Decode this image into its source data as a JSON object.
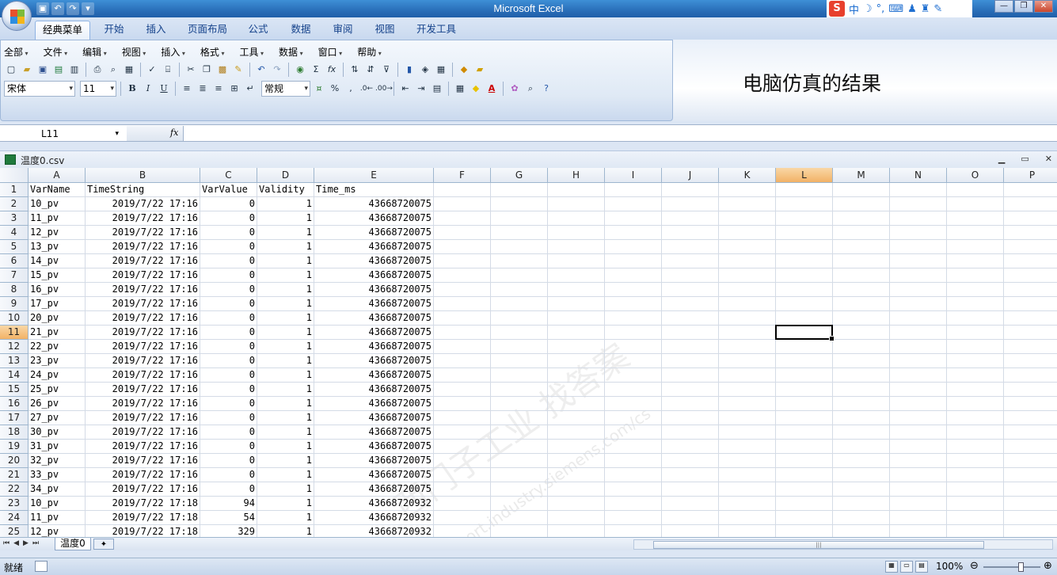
{
  "window": {
    "title": "Microsoft Excel"
  },
  "ime": {
    "logo": "S",
    "lang": "中",
    "moon": "☽",
    "punct": "°,",
    "kbd": "⌨",
    "user": "♟",
    "shirt": "♜",
    "tool": "✎"
  },
  "ribbon_tabs": [
    "经典菜单",
    "开始",
    "插入",
    "页面布局",
    "公式",
    "数据",
    "审阅",
    "视图",
    "开发工具"
  ],
  "classic_menu": [
    "全部",
    "文件",
    "编辑",
    "视图",
    "插入",
    "格式",
    "工具",
    "数据",
    "窗口",
    "帮助"
  ],
  "font": {
    "name": "宋体",
    "size": "11"
  },
  "number_format": "常规",
  "toolbar_glyphs": {
    "bold": "B",
    "italic": "I",
    "underline": "U",
    "percent": "%",
    "comma": ",",
    "sigma": "Σ",
    "fx": "fx",
    "font_color": "A"
  },
  "annotation": "电脑仿真的结果",
  "formula_bar": {
    "name_box": "L11",
    "fx_label": "fx",
    "formula": ""
  },
  "document": {
    "title": "温度0.csv"
  },
  "columns": [
    "A",
    "B",
    "C",
    "D",
    "E",
    "F",
    "G",
    "H",
    "I",
    "J",
    "K",
    "L",
    "M",
    "N",
    "O",
    "P"
  ],
  "selected_column": "L",
  "selected_row": 11,
  "rows": [
    {
      "n": 1,
      "a": "VarName",
      "b": "TimeString",
      "c": "VarValue",
      "d": "Validity",
      "e": "Time_ms",
      "header": true
    },
    {
      "n": 2,
      "a": "10_pv",
      "b": "2019/7/22 17:16",
      "c": "0",
      "d": "1",
      "e": "43668720075"
    },
    {
      "n": 3,
      "a": "11_pv",
      "b": "2019/7/22 17:16",
      "c": "0",
      "d": "1",
      "e": "43668720075"
    },
    {
      "n": 4,
      "a": "12_pv",
      "b": "2019/7/22 17:16",
      "c": "0",
      "d": "1",
      "e": "43668720075"
    },
    {
      "n": 5,
      "a": "13_pv",
      "b": "2019/7/22 17:16",
      "c": "0",
      "d": "1",
      "e": "43668720075"
    },
    {
      "n": 6,
      "a": "14_pv",
      "b": "2019/7/22 17:16",
      "c": "0",
      "d": "1",
      "e": "43668720075"
    },
    {
      "n": 7,
      "a": "15_pv",
      "b": "2019/7/22 17:16",
      "c": "0",
      "d": "1",
      "e": "43668720075"
    },
    {
      "n": 8,
      "a": "16_pv",
      "b": "2019/7/22 17:16",
      "c": "0",
      "d": "1",
      "e": "43668720075"
    },
    {
      "n": 9,
      "a": "17_pv",
      "b": "2019/7/22 17:16",
      "c": "0",
      "d": "1",
      "e": "43668720075"
    },
    {
      "n": 10,
      "a": "20_pv",
      "b": "2019/7/22 17:16",
      "c": "0",
      "d": "1",
      "e": "43668720075"
    },
    {
      "n": 11,
      "a": "21_pv",
      "b": "2019/7/22 17:16",
      "c": "0",
      "d": "1",
      "e": "43668720075"
    },
    {
      "n": 12,
      "a": "22_pv",
      "b": "2019/7/22 17:16",
      "c": "0",
      "d": "1",
      "e": "43668720075"
    },
    {
      "n": 13,
      "a": "23_pv",
      "b": "2019/7/22 17:16",
      "c": "0",
      "d": "1",
      "e": "43668720075"
    },
    {
      "n": 14,
      "a": "24_pv",
      "b": "2019/7/22 17:16",
      "c": "0",
      "d": "1",
      "e": "43668720075"
    },
    {
      "n": 15,
      "a": "25_pv",
      "b": "2019/7/22 17:16",
      "c": "0",
      "d": "1",
      "e": "43668720075"
    },
    {
      "n": 16,
      "a": "26_pv",
      "b": "2019/7/22 17:16",
      "c": "0",
      "d": "1",
      "e": "43668720075"
    },
    {
      "n": 17,
      "a": "27_pv",
      "b": "2019/7/22 17:16",
      "c": "0",
      "d": "1",
      "e": "43668720075"
    },
    {
      "n": 18,
      "a": "30_pv",
      "b": "2019/7/22 17:16",
      "c": "0",
      "d": "1",
      "e": "43668720075"
    },
    {
      "n": 19,
      "a": "31_pv",
      "b": "2019/7/22 17:16",
      "c": "0",
      "d": "1",
      "e": "43668720075"
    },
    {
      "n": 20,
      "a": "32_pv",
      "b": "2019/7/22 17:16",
      "c": "0",
      "d": "1",
      "e": "43668720075"
    },
    {
      "n": 21,
      "a": "33_pv",
      "b": "2019/7/22 17:16",
      "c": "0",
      "d": "1",
      "e": "43668720075"
    },
    {
      "n": 22,
      "a": "34_pv",
      "b": "2019/7/22 17:16",
      "c": "0",
      "d": "1",
      "e": "43668720075"
    },
    {
      "n": 23,
      "a": "10_pv",
      "b": "2019/7/22 17:18",
      "c": "94",
      "d": "1",
      "e": "43668720932"
    },
    {
      "n": 24,
      "a": "11_pv",
      "b": "2019/7/22 17:18",
      "c": "54",
      "d": "1",
      "e": "43668720932"
    },
    {
      "n": 25,
      "a": "12_pv",
      "b": "2019/7/22 17:18",
      "c": "329",
      "d": "1",
      "e": "43668720932"
    }
  ],
  "watermark": {
    "line1": "西门子工业 找答案",
    "line2": "support.industry.siemens.com/cs"
  },
  "sheet_tabs": [
    "温度0"
  ],
  "status": {
    "text": "就绪",
    "zoom": "100%"
  },
  "colors": {
    "selected_header": "#f2b266",
    "ribbon": "#dfe9f5",
    "title_bar": "#2a6fb9"
  }
}
